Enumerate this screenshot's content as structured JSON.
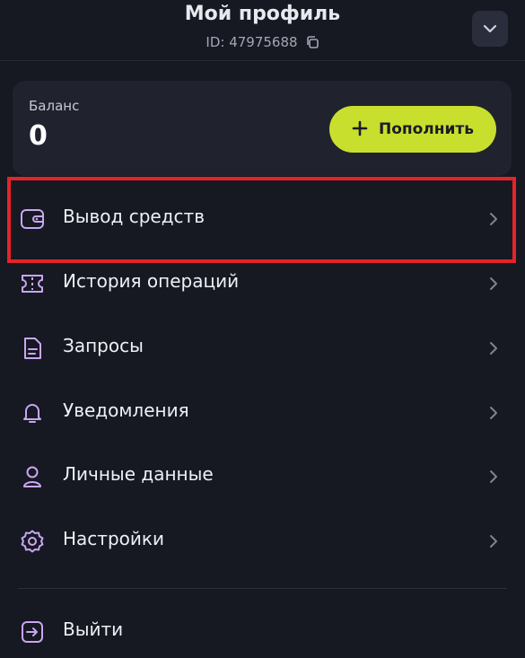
{
  "header": {
    "title": "Мой профиль",
    "id_text": "ID: 47975688",
    "copy_icon": "copy-icon",
    "collapse_icon": "chevron-down-icon"
  },
  "balance": {
    "label": "Баланс",
    "value": "0",
    "topup_label": "Пополнить",
    "topup_icon": "plus-icon"
  },
  "menu": {
    "items": [
      {
        "label": "Вывод средств",
        "icon": "wallet-icon",
        "highlighted": true
      },
      {
        "label": "История операций",
        "icon": "ticket-icon"
      },
      {
        "label": "Запросы",
        "icon": "document-icon"
      },
      {
        "label": "Уведомления",
        "icon": "bell-icon"
      },
      {
        "label": "Личные данные",
        "icon": "user-icon"
      },
      {
        "label": "Настройки",
        "icon": "gear-icon"
      }
    ],
    "logout_label": "Выйти",
    "logout_icon": "logout-icon"
  },
  "colors": {
    "background": "#161822",
    "card": "#20222e",
    "accent_button": "#c8df2e",
    "icon_purple": "#c9a6f2",
    "highlight_border": "#e32429"
  }
}
